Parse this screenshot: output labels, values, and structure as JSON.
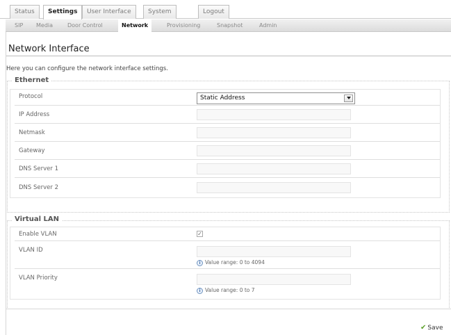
{
  "top_tabs": [
    "Status",
    "Settings",
    "User Interface",
    "System",
    "Logout"
  ],
  "sub_nav": [
    "SIP",
    "Media",
    "Door Control",
    "Network",
    "Provisioning",
    "Snapshot",
    "Admin"
  ],
  "page": {
    "title": "Network Interface",
    "intro": "Here you can configure the network interface settings."
  },
  "ethernet": {
    "legend": "Ethernet",
    "protocol_label": "Protocol",
    "protocol_value": "Static Address",
    "fields": [
      {
        "label": "IP Address",
        "value": ""
      },
      {
        "label": "Netmask",
        "value": ""
      },
      {
        "label": "Gateway",
        "value": ""
      },
      {
        "label": "DNS Server 1",
        "value": ""
      },
      {
        "label": "DNS Server 2",
        "value": ""
      }
    ]
  },
  "vlan": {
    "legend": "Virtual LAN",
    "enable_label": "Enable VLAN",
    "enable_checked": true,
    "vlan_id_label": "VLAN ID",
    "vlan_id_value": "",
    "vlan_id_hint": "Value range: 0 to 4094",
    "priority_label": "VLAN Priority",
    "priority_value": "",
    "priority_hint": "Value range: 0 to 7"
  },
  "save_label": "Save",
  "icons": {
    "dropdown": "chevron-down-icon",
    "info": "info-icon",
    "save": "check-icon"
  },
  "colors": {
    "save_check": "#5ea12c",
    "info_icon": "#416ca4"
  }
}
